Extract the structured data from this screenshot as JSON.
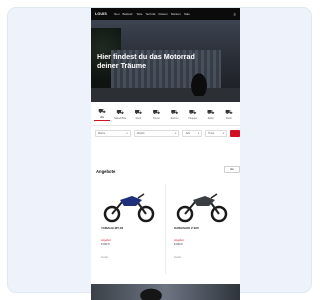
{
  "nav": {
    "logo": "LOUIS",
    "items": [
      "Neu",
      "Bekleid.",
      "Teile",
      "Technik",
      "Reisen",
      "Marken",
      "Sale"
    ],
    "menu_icon": "menu-icon"
  },
  "hero": {
    "headline": "Hier findest du das Motorrad deiner Träume"
  },
  "tabs": [
    {
      "label": "Alle",
      "icon": "motorcycle-icon"
    },
    {
      "label": "Naked Bike",
      "icon": "motorcycle-icon"
    },
    {
      "label": "Sport",
      "icon": "motorcycle-icon"
    },
    {
      "label": "Tourer",
      "icon": "motorcycle-icon"
    },
    {
      "label": "Enduro",
      "icon": "motorcycle-icon"
    },
    {
      "label": "Chopper",
      "icon": "motorcycle-icon"
    },
    {
      "label": "Roller",
      "icon": "scooter-icon"
    },
    {
      "label": "Retro",
      "icon": "motorcycle-icon"
    }
  ],
  "filters": {
    "brand": "Marke",
    "model": "Modell",
    "year": "Jahr",
    "price": "Preis"
  },
  "section": {
    "title": "Angebote",
    "all_label": "Alle"
  },
  "products": [
    {
      "name": "YAMAHA MT-09",
      "label": "Angebot",
      "price": "9.999 €",
      "link": "Details"
    },
    {
      "name": "KAWASAKI Z 900",
      "label": "Angebot",
      "price": "8.999 €",
      "link": "Details"
    }
  ],
  "colors": {
    "accent": "#d30f22",
    "nav_bg": "#0b0b0b",
    "card_bg": "#eef3fb"
  }
}
